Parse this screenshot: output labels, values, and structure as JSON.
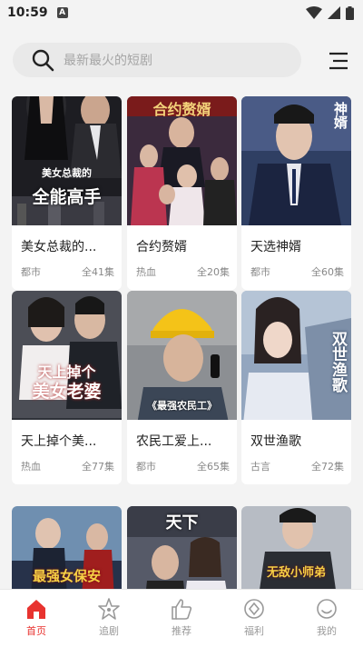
{
  "status": {
    "time": "10:59",
    "notif_letter": "A"
  },
  "search": {
    "placeholder": "最新最火的短剧"
  },
  "dramas": [
    {
      "title": "美女总裁的...",
      "genre": "都市",
      "episodes": "全41集",
      "cover_text": "全能高手",
      "cover_small": "美女总裁的"
    },
    {
      "title": "合约赘婿",
      "genre": "热血",
      "episodes": "全20集",
      "cover_text": "合约赘婿",
      "cover_small": ""
    },
    {
      "title": "天选神婿",
      "genre": "都市",
      "episodes": "全60集",
      "cover_text": "神婿",
      "cover_small": ""
    },
    {
      "title": "天上掉个美...",
      "genre": "热血",
      "episodes": "全77集",
      "cover_text": "美女老婆",
      "cover_small": "天上掉个"
    },
    {
      "title": "农民工爱上...",
      "genre": "都市",
      "episodes": "全65集",
      "cover_text": "《最强农民工》",
      "cover_small": ""
    },
    {
      "title": "双世渔歌",
      "genre": "古言",
      "episodes": "全72集",
      "cover_text": "双世渔歌",
      "cover_small": ""
    },
    {
      "cover_text": "最强女保安"
    },
    {
      "cover_text": "天下"
    },
    {
      "cover_text": "无敌小师弟"
    }
  ],
  "tabs": [
    {
      "label": "首页",
      "icon": "home-icon",
      "active": true
    },
    {
      "label": "追剧",
      "icon": "star-icon",
      "active": false
    },
    {
      "label": "推荐",
      "icon": "thumbs-up-icon",
      "active": false
    },
    {
      "label": "福利",
      "icon": "gift-icon",
      "active": false
    },
    {
      "label": "我的",
      "icon": "smile-icon",
      "active": false
    }
  ],
  "colors": {
    "accent": "#e8332f",
    "background": "#f3f3f3",
    "search_bg": "#e9e9e9"
  }
}
